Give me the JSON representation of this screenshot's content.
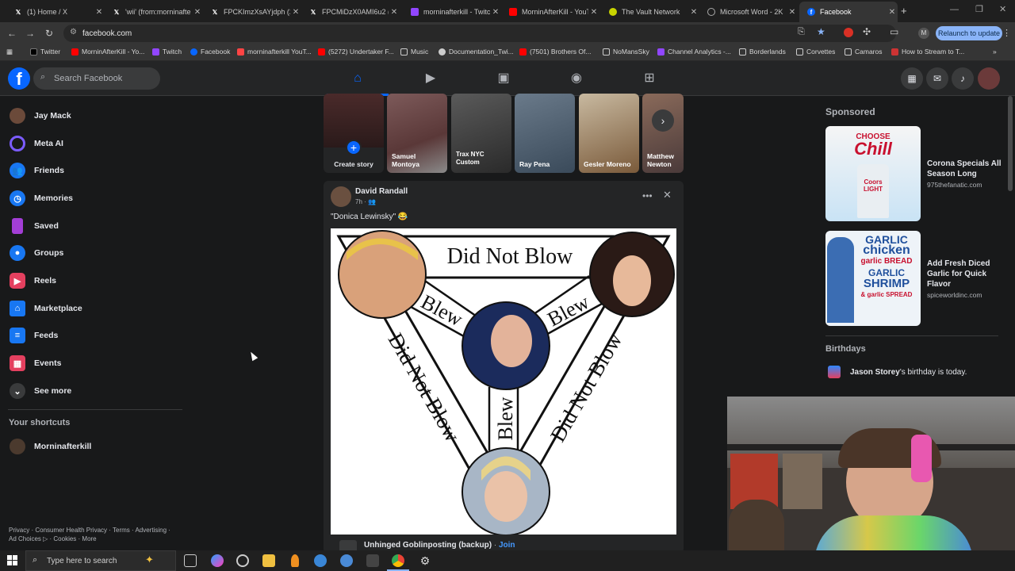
{
  "browser": {
    "tabs": [
      {
        "label": "(1) Home / X",
        "icon": "x-icon"
      },
      {
        "label": "'wii' (from:morninafte",
        "icon": "x-icon"
      },
      {
        "label": "FPCKImzXsAYjdph (20",
        "icon": "x-icon"
      },
      {
        "label": "FPCMiDzX0AMI6u2 (1",
        "icon": "x-icon"
      },
      {
        "label": "morninafterkill - Twitc",
        "icon": "twitch-icon"
      },
      {
        "label": "MorninAfterKill - YouT",
        "icon": "youtube-icon"
      },
      {
        "label": "The Vault Network",
        "icon": "vault-icon"
      },
      {
        "label": "Microsoft Word - 2K",
        "icon": "globe-icon"
      },
      {
        "label": "Facebook",
        "icon": "facebook-icon"
      }
    ],
    "url": "facebook.com",
    "relaunch_label": "Relaunch to update",
    "profile_initial": "M",
    "bookmarks": [
      {
        "label": "Twitter",
        "color": "#000000"
      },
      {
        "label": "MorninAfterKill - Yo...",
        "color": "#ff0000"
      },
      {
        "label": "Twitch",
        "color": "#9146ff"
      },
      {
        "label": "Facebook",
        "color": "#0866ff"
      },
      {
        "label": "morninafterkill YouT...",
        "color": "#ff4444"
      },
      {
        "label": "(5272) Undertaker F...",
        "color": "#ff0000"
      },
      {
        "label": "Music",
        "color": "folder"
      },
      {
        "label": "Documentation_Twi...",
        "color": "#cccccc"
      },
      {
        "label": "(7501) Brothers Of...",
        "color": "#ff0000"
      },
      {
        "label": "NoMansSky",
        "color": "folder"
      },
      {
        "label": "Channel Analytics -...",
        "color": "#9146ff"
      },
      {
        "label": "Borderlands",
        "color": "folder"
      },
      {
        "label": "Corvettes",
        "color": "folder"
      },
      {
        "label": "Camaros",
        "color": "folder"
      },
      {
        "label": "How to Stream to T...",
        "color": "#cc3333"
      }
    ]
  },
  "header": {
    "search_placeholder": "Search Facebook"
  },
  "sidebar": {
    "items": [
      {
        "label": "Jay Mack",
        "icon": "avatar"
      },
      {
        "label": "Meta AI",
        "icon": "meta-ai-icon"
      },
      {
        "label": "Friends",
        "icon": "friends-icon"
      },
      {
        "label": "Memories",
        "icon": "clock-icon"
      },
      {
        "label": "Saved",
        "icon": "bookmark-icon"
      },
      {
        "label": "Groups",
        "icon": "groups-icon"
      },
      {
        "label": "Reels",
        "icon": "reels-icon"
      },
      {
        "label": "Marketplace",
        "icon": "marketplace-icon"
      },
      {
        "label": "Feeds",
        "icon": "feeds-icon"
      },
      {
        "label": "Events",
        "icon": "calendar-icon"
      },
      {
        "label": "See more",
        "icon": "chevron-down-icon"
      }
    ],
    "shortcuts_heading": "Your shortcuts",
    "shortcut": "Morninafterkill",
    "footer_line1": "Privacy · Consumer Health Privacy · Terms · Advertising ·",
    "footer_line2": "Ad Choices ▷ · Cookies · More"
  },
  "stories": [
    {
      "name": "Create story"
    },
    {
      "name": "Samuel Montoya"
    },
    {
      "name": "Ray Pena"
    },
    {
      "name": "Gesler Moreno"
    },
    {
      "name": "Matthew Newton"
    }
  ],
  "story_overlay_text": "Trax NYC Custom",
  "post": {
    "author": "David Randall",
    "time": "7h · ",
    "caption": "\"Donica Lewinsky\" 😂",
    "meme": {
      "top": "Did Not Blow",
      "blew_left": "Blew",
      "blew_right": "Blew",
      "left": "Did Not Blow",
      "right": "Did Not Blow",
      "center": "Blew"
    },
    "next_author": "Unhinged Goblinposting (backup)",
    "join_label": "Join"
  },
  "right": {
    "sponsored_heading": "Sponsored",
    "ads": [
      {
        "title": "Corona Specials All Season Long",
        "url": "975thefanatic.com",
        "img_top": "CHOOSE",
        "img_main": "Chill",
        "img_brand": "Coors LIGHT"
      },
      {
        "title": "Add Fresh Diced Garlic for Quick Flavor",
        "url": "spiceworldinc.com",
        "img_lines": [
          "GARLIC",
          "chicken",
          "garlic BREAD",
          "GARLIC",
          "SHRIMP",
          "& garlic SPREAD"
        ]
      }
    ],
    "birthdays_heading": "Birthdays",
    "birthday_name": "Jason Storey",
    "birthday_text": "'s birthday is today."
  },
  "taskbar": {
    "search_placeholder": "Type here to search"
  }
}
